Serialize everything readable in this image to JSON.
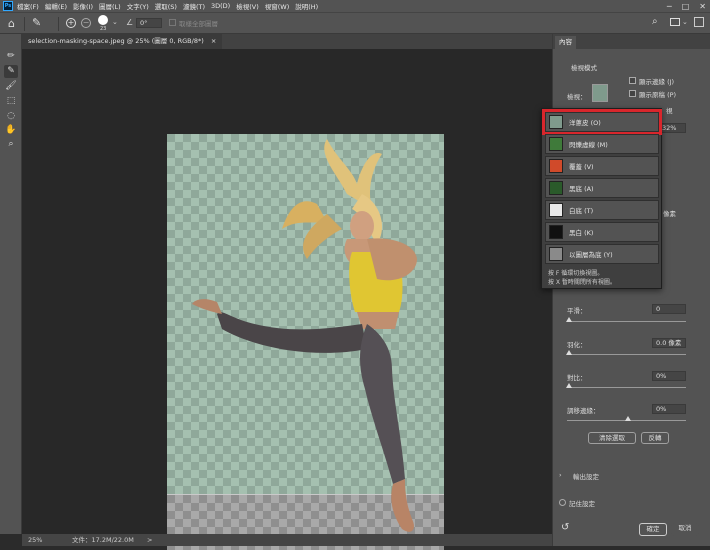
{
  "menu": [
    "檔案(F)",
    "編輯(E)",
    "影像(I)",
    "圖層(L)",
    "文字(Y)",
    "選取(S)",
    "濾鏡(T)",
    "3D(D)",
    "檢視(V)",
    "視窗(W)",
    "說明(H)"
  ],
  "window_controls": [
    "─",
    "□",
    "✕"
  ],
  "options": {
    "brush_size": "23",
    "angle": "0°",
    "sample_all_layers": "取樣全部圖層"
  },
  "doc_tab": {
    "title": "selection-masking-space.jpeg @ 25% (圖層 0, RGB/8*)",
    "close": "×"
  },
  "status": {
    "zoom": "25%",
    "doc": "文件：17.2M/22.0M",
    "arrow": ">"
  },
  "panel": {
    "tab": "內容",
    "view_mode_title": "檢視模式",
    "view_label": "檢視：",
    "show_edge": "顯示邊緣 (J)",
    "show_original": "顯示原稿 (P)",
    "partial_1": "視",
    "partial_pct": "32%",
    "partial_px": "像素",
    "smooth_label": "平滑：",
    "smooth_value": "0",
    "feather_label": "羽化：",
    "feather_value": "0.0 像素",
    "contrast_label": "對比：",
    "contrast_value": "0%",
    "shift_label": "調移邊緣：",
    "shift_value": "0%",
    "clear_button": "清除選取",
    "invert_button": "反轉",
    "output_settings": "輸出設定",
    "remember": "記住設定",
    "ok": "確定",
    "cancel": "取消",
    "chevron": "›",
    "reset_icon": "↺"
  },
  "view_menu": {
    "items": [
      {
        "label": "洋蔥皮 (O)",
        "color": "#7f9a8c"
      },
      {
        "label": "閃爍虛線 (M)",
        "color": "#3f7a3a"
      },
      {
        "label": "覆蓋 (V)",
        "color": "#d04a2a"
      },
      {
        "label": "黑底 (A)",
        "color": "#2a5a2a"
      },
      {
        "label": "白底 (T)",
        "color": "#e8e8e8"
      },
      {
        "label": "黑白 (K)",
        "color": "#111111"
      },
      {
        "label": "以圖層為底 (Y)",
        "color": "#8a8a8a"
      }
    ],
    "hint1": "按 F 循環切換視圖。",
    "hint2": "按 X 暫時關閉所有視圖。"
  },
  "colors": {
    "highlight": "#d8262c",
    "canvas": "#282828",
    "panel": "#535353"
  }
}
